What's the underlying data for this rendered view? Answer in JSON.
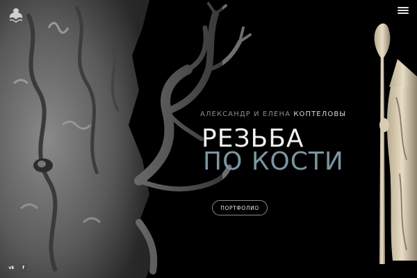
{
  "header": {
    "logo_icon": "swan-emblem-icon",
    "menu_icon": "hamburger-menu-icon"
  },
  "hero": {
    "authors_first": "АЛЕКСАНДР И ЕЛЕНА",
    "authors_last": "КОПТЕЛОВЫ",
    "title_line1": "РЕЗЬБА",
    "title_line2": "ПО КОСТИ",
    "portfolio_label": "ПОРТФОЛИО"
  },
  "social": {
    "vk_label": "vk",
    "fb_label": "f"
  },
  "colors": {
    "background": "#000000",
    "title_primary": "#f2f2f2",
    "title_accent": "#7c96a0",
    "names_muted": "#8d8d8d",
    "names_bright": "#d9d9d9"
  }
}
